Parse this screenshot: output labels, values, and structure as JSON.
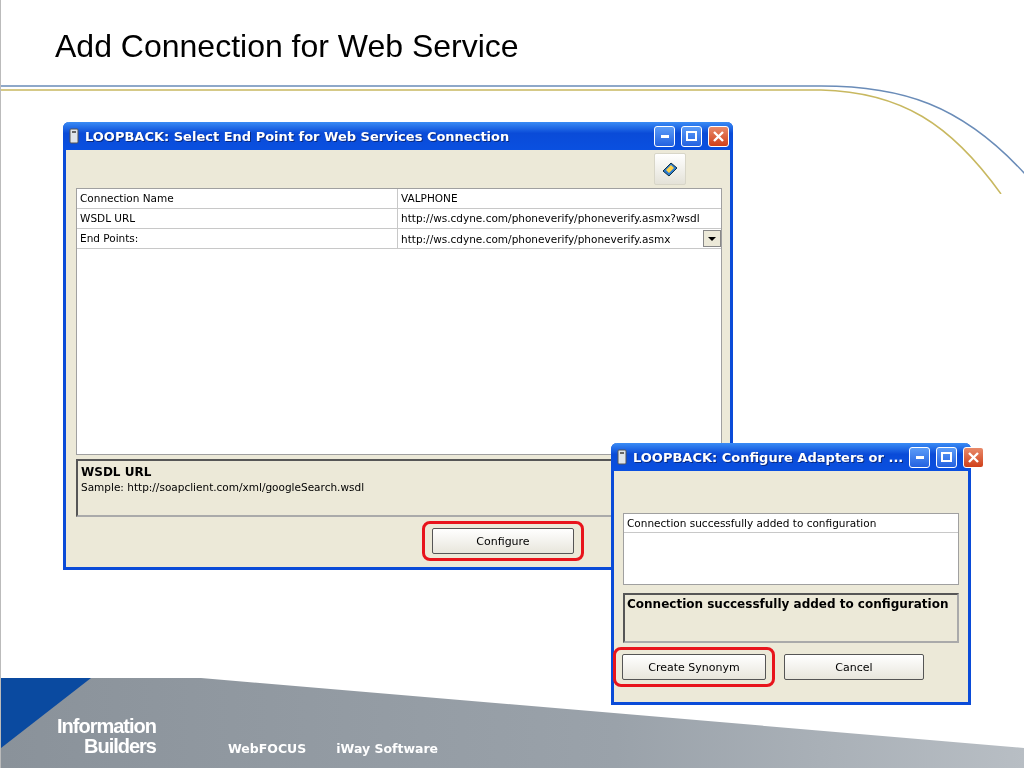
{
  "slide": {
    "title": "Add Connection for Web Service"
  },
  "main_window": {
    "title": "LOOPBACK: Select End Point for Web Services Connection",
    "properties": [
      {
        "label": "Connection Name",
        "value": "VALPHONE",
        "kind": "text"
      },
      {
        "label": "WSDL URL",
        "value": "http://ws.cdyne.com/phoneverify/phoneverify.asmx?wsdl",
        "kind": "text"
      },
      {
        "label": "End Points:",
        "value": "http://ws.cdyne.com/phoneverify/phoneverify.asmx",
        "kind": "dropdown"
      }
    ],
    "help": {
      "title": "WSDL URL",
      "text": "Sample: http://soapclient.com/xml/googleSearch.wsdl"
    },
    "buttons": [
      {
        "label": "Configure",
        "highlighted": true
      }
    ]
  },
  "dialog": {
    "title": "LOOPBACK: Configure Adapters or ...",
    "messages": [
      "Connection successfully added to configuration"
    ],
    "status": "Connection successfully added to configuration",
    "buttons": [
      {
        "label": "Create Synonym",
        "highlighted": true
      },
      {
        "label": "Cancel",
        "highlighted": false
      }
    ]
  },
  "footer": {
    "logo_lines": [
      "Information",
      "Builders"
    ],
    "links": [
      "WebFOCUS",
      "iWay Software"
    ]
  }
}
